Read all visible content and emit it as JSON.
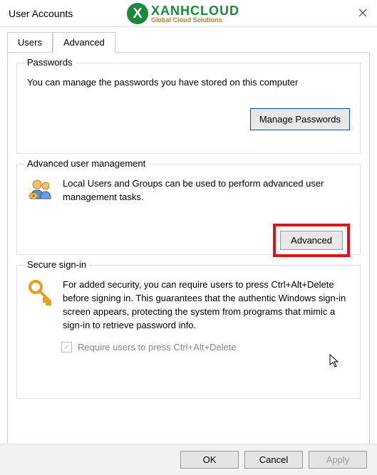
{
  "titlebar": {
    "title": "User Accounts"
  },
  "logo": {
    "letter": "X",
    "main": "XANHCLOUD",
    "sub": "Global Cloud Solutions"
  },
  "tabs": {
    "users": "Users",
    "advanced": "Advanced"
  },
  "passwords": {
    "title": "Passwords",
    "text": "You can manage the passwords you have stored on this computer",
    "button": "Manage Passwords"
  },
  "advanced_mgmt": {
    "title": "Advanced user management",
    "text": "Local Users and Groups can be used to perform advanced user management tasks.",
    "button": "Advanced"
  },
  "secure": {
    "title": "Secure sign-in",
    "text": "For added security, you can require users to press Ctrl+Alt+Delete before signing in. This guarantees that the authentic Windows sign-in screen appears, protecting the system from programs that mimic a sign-in to retrieve password info.",
    "checkbox_label": "Require users to press Ctrl+Alt+Delete"
  },
  "footer": {
    "ok": "OK",
    "cancel": "Cancel",
    "apply": "Apply"
  }
}
